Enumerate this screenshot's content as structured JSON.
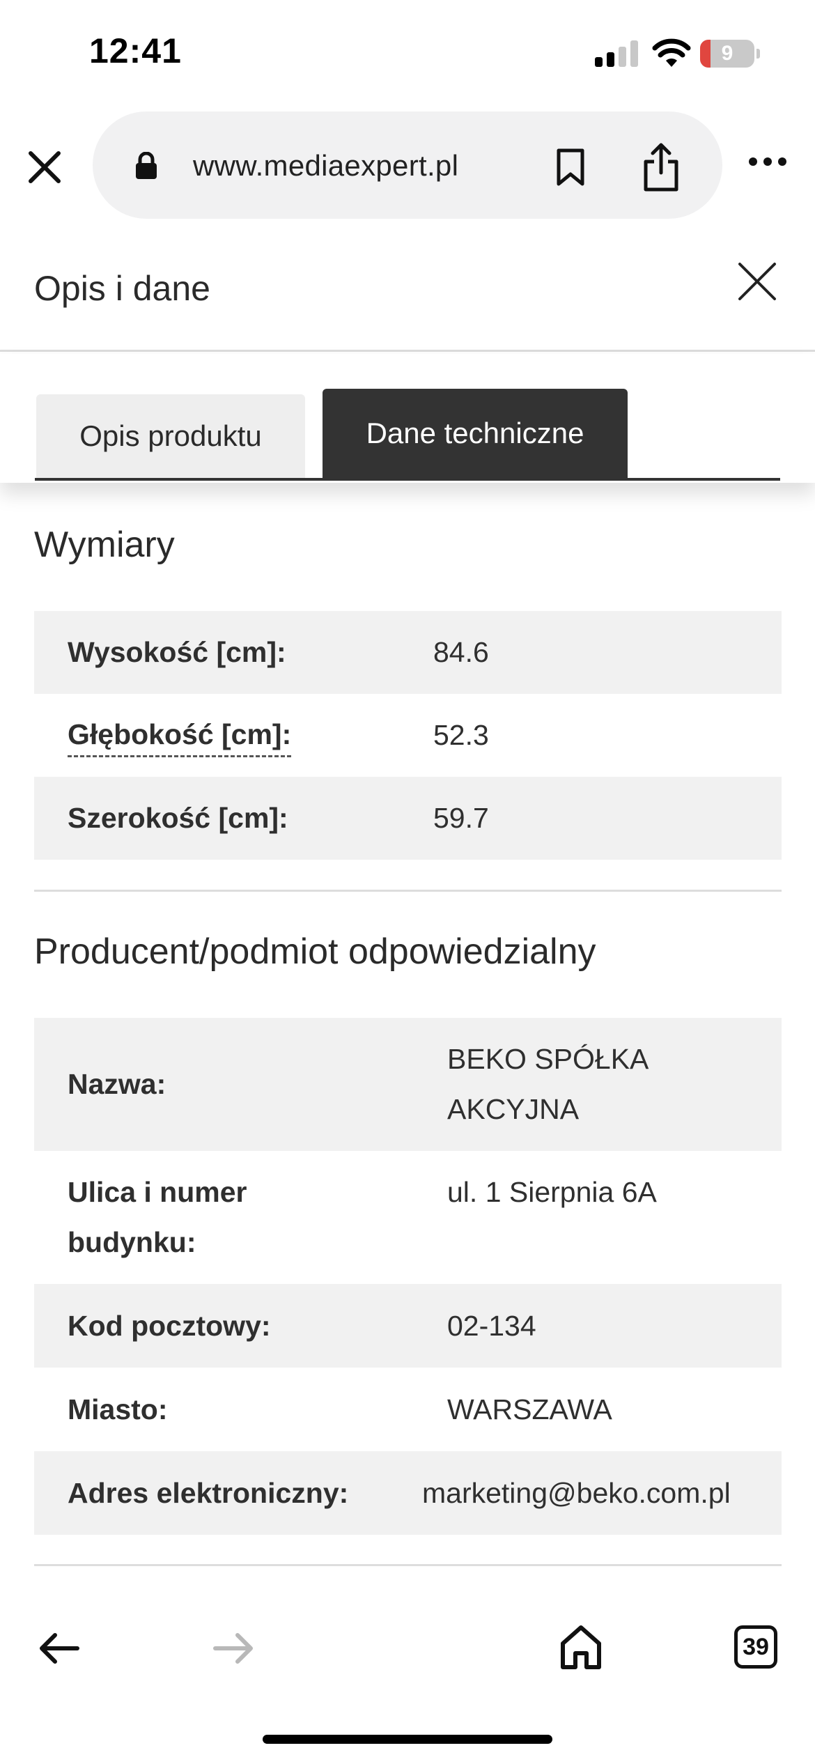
{
  "status_bar": {
    "time": "12:41",
    "battery_level_text": "9",
    "battery_level_fraction": 0.09,
    "signal_bars_active": 2,
    "signal_bars_total": 4
  },
  "browser": {
    "url": "www.mediaexpert.pl",
    "tabs_count": "39",
    "icons": {
      "close": "close-icon",
      "lock": "lock-icon",
      "bookmark": "bookmark-icon",
      "share": "share-icon",
      "more": "more-icon",
      "back": "arrow-left-icon",
      "forward": "arrow-right-icon",
      "home": "home-icon",
      "tabs": "tabs-icon"
    }
  },
  "modal": {
    "title": "Opis i dane",
    "tabs": [
      {
        "label": "Opis produktu",
        "active": false
      },
      {
        "label": "Dane techniczne",
        "active": true
      }
    ]
  },
  "sections": [
    {
      "title": "Wymiary",
      "rows": [
        {
          "label": "Wysokość [cm]:",
          "value": "84.6"
        },
        {
          "label": "Głębokość [cm]:",
          "value": "52.3"
        },
        {
          "label": "Szerokość [cm]:",
          "value": "59.7"
        }
      ]
    },
    {
      "title": "Producent/podmiot odpowiedzialny",
      "rows": [
        {
          "label": "Nazwa:",
          "value_lines": [
            "BEKO SPÓŁKA",
            "AKCYJNA"
          ]
        },
        {
          "label_lines": [
            "Ulica i numer",
            "budynku:"
          ],
          "value": "ul. 1 Sierpnia 6A"
        },
        {
          "label": "Kod pocztowy:",
          "value": "02-134"
        },
        {
          "label": "Miasto:",
          "value": "WARSZAWA"
        },
        {
          "label": "Adres elektroniczny:",
          "value": "marketing@beko.com.pl"
        }
      ]
    }
  ],
  "colors": {
    "active_tab_bg": "#333333",
    "inactive_tab_bg": "#eeeeee",
    "row_shade": "#f1f1f1",
    "battery_low": "#e0463f"
  }
}
